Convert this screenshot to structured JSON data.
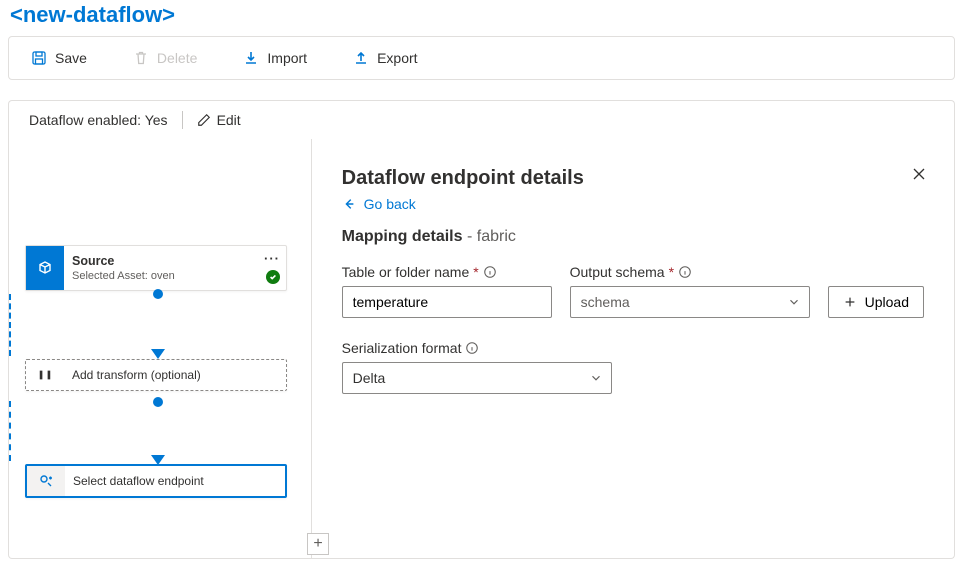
{
  "title": "<new-dataflow>",
  "toolbar": {
    "save": "Save",
    "delete": "Delete",
    "import": "Import",
    "export": "Export"
  },
  "status": {
    "enabled_label": "Dataflow enabled: Yes",
    "edit": "Edit"
  },
  "canvas": {
    "source": {
      "title": "Source",
      "subtitle": "Selected Asset: oven"
    },
    "transform": {
      "title": "Add transform (optional)"
    },
    "dest": {
      "title": "Select dataflow endpoint"
    },
    "add": "+"
  },
  "panel": {
    "heading": "Dataflow endpoint details",
    "go_back": "Go back",
    "mapping_title": "Mapping details",
    "mapping_sub": "fabric",
    "table_label": "Table or folder name",
    "table_value": "temperature",
    "schema_label": "Output schema",
    "schema_placeholder": "schema",
    "upload": "Upload",
    "serialization_label": "Serialization format",
    "serialization_value": "Delta"
  }
}
